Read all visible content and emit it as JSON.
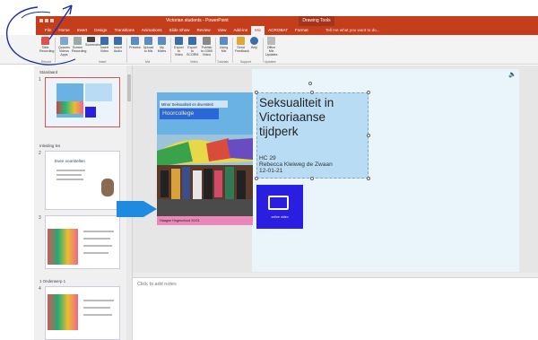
{
  "window": {
    "title": "Victorian students - PowerPoint",
    "context_tab": "Drawing Tools"
  },
  "tabs": [
    "File",
    "Home",
    "Insert",
    "Design",
    "Transitions",
    "Animations",
    "Slide Show",
    "Review",
    "View",
    "Add-ins",
    "Mix",
    "ACROBAT",
    "Format"
  ],
  "tell_me": "Tell me what you want to do...",
  "ribbon": {
    "buttons": [
      {
        "label": "Slide Recording",
        "icon": "slide-recording-icon"
      },
      {
        "label": "Quizzes Videos Apps",
        "icon": "quiz-icon"
      },
      {
        "label": "Screen Recording",
        "icon": "screen-recording-icon"
      },
      {
        "label": "Screenshot",
        "icon": "screenshot-icon"
      },
      {
        "label": "Insert Video",
        "icon": "insert-video-icon"
      },
      {
        "label": "Insert Audio",
        "icon": "insert-audio-icon"
      },
      {
        "label": "Preview",
        "icon": "preview-icon"
      },
      {
        "label": "Upload to Mix",
        "icon": "upload-icon"
      },
      {
        "label": "My Mixes",
        "icon": "my-mixes-icon"
      },
      {
        "label": "Export to Video",
        "icon": "export-video-icon"
      },
      {
        "label": "Export to SCORM",
        "icon": "export-scorm-icon"
      },
      {
        "label": "Publish to O365 Video",
        "icon": "publish-icon"
      },
      {
        "label": "Using Mix",
        "icon": "using-mix-icon"
      },
      {
        "label": "Send Feedback",
        "icon": "feedback-icon"
      },
      {
        "label": "Help",
        "icon": "help-icon"
      },
      {
        "label": "Office Mix Updates",
        "icon": "updates-icon"
      }
    ],
    "groups": [
      "Record",
      "Insert",
      "Mix",
      "Video",
      "Tutorials",
      "Support",
      "Updates"
    ]
  },
  "thumbnails": {
    "sections": [
      "Inleiding les",
      "1 Onderwerp 1"
    ],
    "first_section_label": "Standaard",
    "numbers": [
      "1",
      "2",
      "3",
      "4"
    ],
    "slide2_title": "Even voorstellen"
  },
  "slide": {
    "kicker": "Minor Seksualiteit en diversiteit",
    "lecture": "Hoorcollege",
    "title": "Seksualiteit in Victoriaanse tijdperk",
    "subtitle_lines": [
      "HC 29",
      "Rebecca Kleiweg de Zwaan",
      "12-01-21"
    ],
    "footer": "Haagse Hogeschool 20/21",
    "video_label": "online video"
  },
  "notes": {
    "placeholder": "Click to add notes"
  },
  "colors": {
    "accent": "#c43e1c",
    "slide_bg": "#e9f4fb",
    "block": "#6ab1e4",
    "pink": "#ea86b8",
    "video": "#2a1fe0"
  }
}
